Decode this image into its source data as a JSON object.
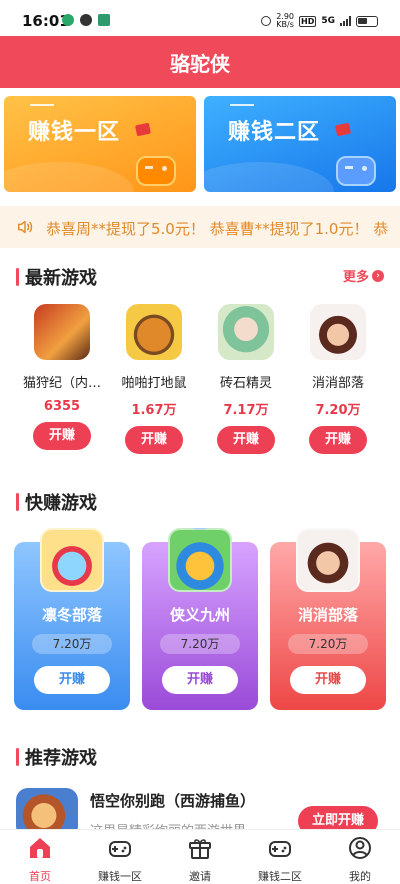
{
  "status_bar": {
    "time": "16:01",
    "speed": "2.90",
    "speed_unit": "KB/s",
    "hd": "HD",
    "net": "5G"
  },
  "header": {
    "title": "骆驼侠"
  },
  "banners": [
    {
      "title": "赚钱一区",
      "accent": "#ff9518"
    },
    {
      "title": "赚钱二区",
      "accent": "#1777ea"
    }
  ],
  "notice": {
    "text": "恭喜周**提现了5.0元！  恭喜曹**提现了1.0元！  恭"
  },
  "latest_section": {
    "title": "最新游戏",
    "more_label": "更多"
  },
  "latest_games": [
    {
      "name": "猫狩纪（内…",
      "value": "6355",
      "button": "开赚"
    },
    {
      "name": "啪啪打地鼠",
      "value": "1.67万",
      "button": "开赚"
    },
    {
      "name": "砖石精灵",
      "value": "7.17万",
      "button": "开赚"
    },
    {
      "name": "消消部落",
      "value": "7.20万",
      "button": "开赚"
    }
  ],
  "quick_section": {
    "title": "快赚游戏"
  },
  "quick_games": [
    {
      "name": "凛冬部落",
      "value": "7.20万",
      "button": "开赚"
    },
    {
      "name": "侠义九州",
      "value": "7.20万",
      "button": "开赚"
    },
    {
      "name": "消消部落",
      "value": "7.20万",
      "button": "开赚"
    }
  ],
  "recommend_section": {
    "title": "推荐游戏"
  },
  "recommend_game": {
    "name": "悟空你别跑（西游捕鱼）",
    "desc": "这里是精彩绚丽的西游世界…",
    "button": "立即开赚"
  },
  "bottom_nav": [
    {
      "label": "首页",
      "icon": "home-icon",
      "active": true
    },
    {
      "label": "赚钱一区",
      "icon": "gamepad-icon",
      "active": false
    },
    {
      "label": "邀请",
      "icon": "gift-icon",
      "active": false
    },
    {
      "label": "赚钱二区",
      "icon": "gamepad-icon",
      "active": false
    },
    {
      "label": "我的",
      "icon": "user-icon",
      "active": false
    }
  ],
  "colors": {
    "brand": "#f04a5a",
    "notice_text": "#e08a2c"
  }
}
